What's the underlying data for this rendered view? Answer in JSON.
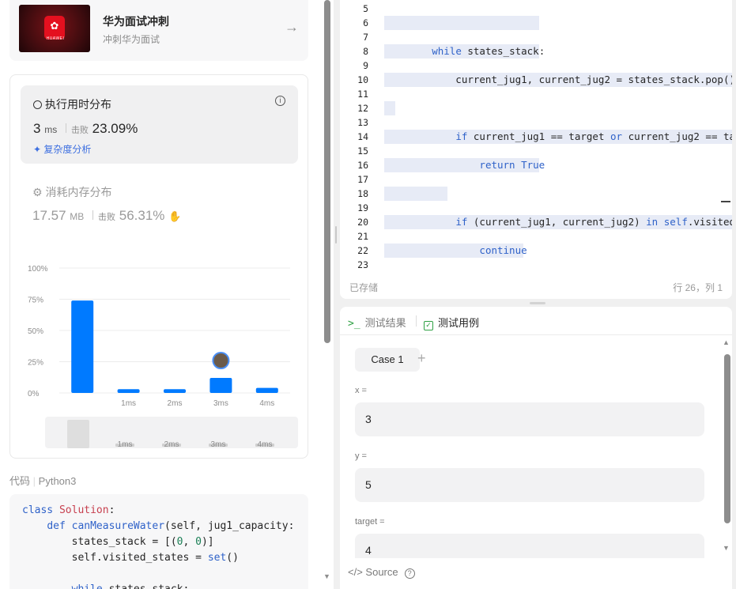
{
  "promo": {
    "title": "华为面试冲刺",
    "subtitle": "冲刺华为面试",
    "logo_text": "HUAWEI"
  },
  "runtime": {
    "heading": "执行用时分布",
    "value": "3",
    "unit": "ms",
    "beats_label": "击败",
    "beats_value": "23.09%",
    "analysis_link": "复杂度分析"
  },
  "memory": {
    "heading": "消耗内存分布",
    "value": "17.57",
    "unit": "MB",
    "beats_label": "击败",
    "beats_value": "56.31%"
  },
  "chart_data": {
    "type": "bar",
    "categories": [
      "",
      "1ms",
      "2ms",
      "3ms",
      "4ms"
    ],
    "values": [
      74,
      3,
      3,
      12,
      4
    ],
    "ylim": [
      0,
      100
    ],
    "yticks": [
      "0%",
      "25%",
      "50%",
      "75%",
      "100%"
    ],
    "highlighted_category": "3ms",
    "grid": true,
    "slider_labels": [
      "1ms",
      "2ms",
      "3ms",
      "4ms"
    ]
  },
  "code_panel": {
    "label": "代码",
    "language": "Python3"
  },
  "editor": {
    "line_numbers": [
      "5",
      "6",
      "7",
      "8",
      "9",
      "10",
      "11",
      "12",
      "13",
      "14",
      "15",
      "16",
      "17",
      "18",
      "19",
      "20",
      "21",
      "22",
      "23"
    ],
    "saved_status": "已存储",
    "cursor_position": "行 26，列 1"
  },
  "tests": {
    "tab_results": "测试结果",
    "tab_cases": "测试用例",
    "case_label": "Case 1",
    "fields": [
      {
        "name": "x =",
        "value": "3"
      },
      {
        "name": "y =",
        "value": "5"
      },
      {
        "name": "target =",
        "value": "4"
      }
    ],
    "source_label": "Source"
  }
}
